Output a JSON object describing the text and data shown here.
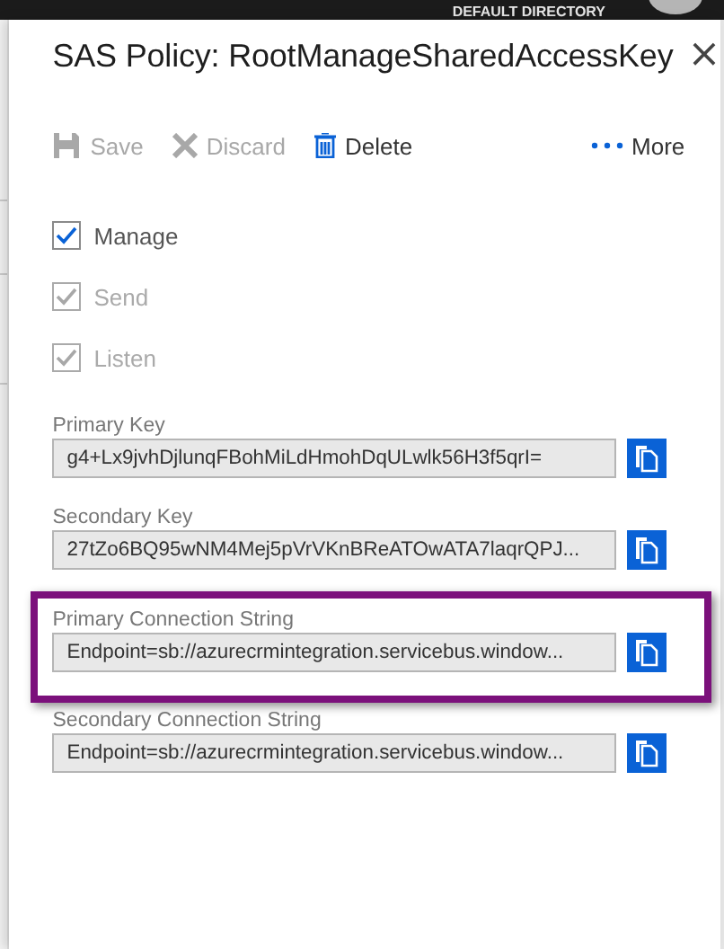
{
  "top_bar": {
    "directory": "DEFAULT DIRECTORY"
  },
  "panel": {
    "title": "SAS Policy: RootManageSharedAccessKey",
    "close": "×"
  },
  "toolbar": [
    {
      "kind": "save",
      "label": "Save",
      "disabled": true
    },
    {
      "kind": "discard",
      "label": "Discard",
      "disabled": true
    },
    {
      "kind": "delete",
      "label": "Delete",
      "disabled": false
    },
    {
      "kind": "more",
      "label": "More",
      "disabled": false
    }
  ],
  "claims": [
    {
      "label": "Manage",
      "checked": true,
      "disabled": false
    },
    {
      "label": "Send",
      "checked": true,
      "disabled": true
    },
    {
      "label": "Listen",
      "checked": true,
      "disabled": true
    }
  ],
  "keys": [
    {
      "label": "Primary Key",
      "value": "g4+Lx9jvhDjlunqFBohMiLdHmohDqULwlk56H3f5qrI=",
      "highlighted": false
    },
    {
      "label": "Secondary Key",
      "value": "27tZo6BQ95wNM4Mej5pVrVKnBReATOwATA7laqrQPJ...",
      "highlighted": false
    },
    {
      "label": "Primary Connection String",
      "value": "Endpoint=sb://azurecrmintegration.servicebus.window...",
      "highlighted": true
    },
    {
      "label": "Secondary Connection String",
      "value": "Endpoint=sb://azurecrmintegration.servicebus.window...",
      "highlighted": false
    }
  ]
}
